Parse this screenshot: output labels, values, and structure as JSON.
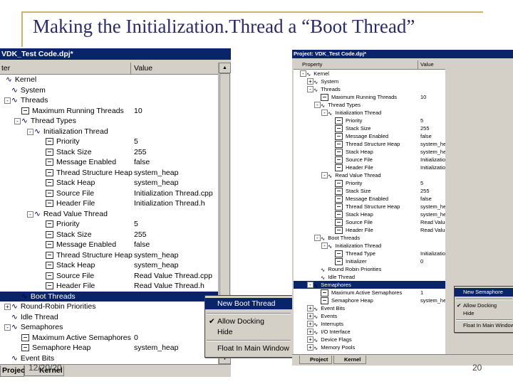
{
  "slide": {
    "title": "Making the Initialization.Thread  a “Boot Thread”",
    "date": "12/20/20",
    "page": "20"
  },
  "colors": {
    "accent_line": "#c9b66a",
    "title_bar": "#0a246a",
    "selection": "#0a246a",
    "panel": "#d4d0c8"
  },
  "left_window": {
    "title": "VDK_Test Code.dpj*",
    "columns": [
      "ter",
      "Value"
    ],
    "rows": [
      {
        "name": "Kernel",
        "value": "",
        "icon": "kernel-icon"
      },
      {
        "name": "System",
        "value": "",
        "icon": "system-icon"
      },
      {
        "name": "Threads",
        "value": "",
        "icon": "threads-icon"
      },
      {
        "name": "Maximum Running Threads",
        "value": "10",
        "icon": "property-icon"
      },
      {
        "name": "Thread Types",
        "value": "",
        "icon": "thread-types-icon"
      },
      {
        "name": "Initialization Thread",
        "value": "",
        "icon": "thread-icon"
      },
      {
        "name": "Priority",
        "value": "5",
        "icon": "property-icon"
      },
      {
        "name": "Stack Size",
        "value": "255",
        "icon": "property-icon"
      },
      {
        "name": "Message Enabled",
        "value": "false",
        "icon": "property-icon"
      },
      {
        "name": "Thread Structure Heap",
        "value": "system_heap",
        "icon": "property-icon"
      },
      {
        "name": "Stack Heap",
        "value": "system_heap",
        "icon": "property-icon"
      },
      {
        "name": "Source File",
        "value": "Initialization Thread.cpp",
        "icon": "property-icon"
      },
      {
        "name": "Header File",
        "value": "Initialization Thread.h",
        "icon": "property-icon"
      },
      {
        "name": "Read Value Thread",
        "value": "",
        "icon": "thread-icon"
      },
      {
        "name": "Priority",
        "value": "5",
        "icon": "property-icon"
      },
      {
        "name": "Stack Size",
        "value": "255",
        "icon": "property-icon"
      },
      {
        "name": "Message Enabled",
        "value": "false",
        "icon": "property-icon"
      },
      {
        "name": "Thread Structure Heap",
        "value": "system_heap",
        "icon": "property-icon"
      },
      {
        "name": "Stack Heap",
        "value": "system_heap",
        "icon": "property-icon"
      },
      {
        "name": "Source File",
        "value": "Read Value Thread.cpp",
        "icon": "property-icon"
      },
      {
        "name": "Header File",
        "value": "Read Value Thread.h",
        "icon": "property-icon"
      },
      {
        "name": "Boot Threads",
        "value": "",
        "icon": "boot-threads-icon"
      },
      {
        "name": "Round-Robin Priorities",
        "value": "",
        "icon": "round-robin-icon"
      },
      {
        "name": "Idle Thread",
        "value": "",
        "icon": "idle-thread-icon"
      },
      {
        "name": "Semaphores",
        "value": "",
        "icon": "semaphores-icon"
      },
      {
        "name": "Maximum Active Semaphores",
        "value": "0",
        "icon": "property-icon"
      },
      {
        "name": "Semaphore Heap",
        "value": "system_heap",
        "icon": "property-icon"
      },
      {
        "name": "Event Bits",
        "value": "",
        "icon": "event-bits-icon"
      }
    ],
    "tabs": [
      "Project",
      "Kernel"
    ],
    "context_menu": {
      "items": [
        "New Boot Thread",
        "Allow Docking",
        "Hide",
        "Float In Main Window"
      ],
      "checked": "Allow Docking",
      "highlighted": "New Boot Thread"
    }
  },
  "right_window": {
    "title": "Project: VDK_Test Code.dpj*",
    "columns": [
      "Property",
      "Value"
    ],
    "rows": [
      {
        "name": "Kernel",
        "value": "",
        "icon": "kernel-icon"
      },
      {
        "name": "System",
        "value": "",
        "icon": "system-icon"
      },
      {
        "name": "Threads",
        "value": "",
        "icon": "threads-icon"
      },
      {
        "name": "Maximum Running Threads",
        "value": "10",
        "icon": "property-icon"
      },
      {
        "name": "Thread Types",
        "value": "",
        "icon": "thread-types-icon"
      },
      {
        "name": "Initialization Thread",
        "value": "",
        "icon": "thread-icon"
      },
      {
        "name": "Priority",
        "value": "5",
        "icon": "property-icon"
      },
      {
        "name": "Stack Size",
        "value": "255",
        "icon": "property-icon"
      },
      {
        "name": "Message Enabled",
        "value": "false",
        "icon": "property-icon"
      },
      {
        "name": "Thread Structure Heap",
        "value": "system_heap",
        "icon": "property-icon"
      },
      {
        "name": "Stack Heap",
        "value": "system_heap",
        "icon": "property-icon"
      },
      {
        "name": "Source File",
        "value": "Initialization Thread.cpp",
        "icon": "property-icon"
      },
      {
        "name": "Header File",
        "value": "Initialization Thread.h",
        "icon": "property-icon"
      },
      {
        "name": "Read Value Thread",
        "value": "",
        "icon": "thread-icon"
      },
      {
        "name": "Priority",
        "value": "5",
        "icon": "property-icon"
      },
      {
        "name": "Stack Size",
        "value": "255",
        "icon": "property-icon"
      },
      {
        "name": "Message Enabled",
        "value": "false",
        "icon": "property-icon"
      },
      {
        "name": "Thread Structure Heap",
        "value": "system_heap",
        "icon": "property-icon"
      },
      {
        "name": "Stack Heap",
        "value": "system_heap",
        "icon": "property-icon"
      },
      {
        "name": "Source File",
        "value": "Read Value Thread.cpp",
        "icon": "property-icon"
      },
      {
        "name": "Header File",
        "value": "Read Value Thread.h",
        "icon": "property-icon"
      },
      {
        "name": "Boot Threads",
        "value": "",
        "icon": "boot-threads-icon"
      },
      {
        "name": "Initialization Thread",
        "value": "",
        "icon": "thread-icon"
      },
      {
        "name": "Thread Type",
        "value": "Initialization Thread",
        "icon": "property-icon"
      },
      {
        "name": "Initializer",
        "value": "0",
        "icon": "property-icon"
      },
      {
        "name": "Round Robin Priorities",
        "value": "",
        "icon": "round-robin-icon"
      },
      {
        "name": "Idle Thread",
        "value": "",
        "icon": "idle-thread-icon"
      },
      {
        "name": "Semaphores",
        "value": "",
        "icon": "semaphores-icon"
      },
      {
        "name": "Maximum Active Semaphores",
        "value": "1",
        "icon": "property-icon"
      },
      {
        "name": "Semaphore Heap",
        "value": "system_heap",
        "icon": "property-icon"
      },
      {
        "name": "Event Bits",
        "value": "",
        "icon": "event-bits-icon"
      },
      {
        "name": "Events",
        "value": "",
        "icon": "events-icon"
      },
      {
        "name": "Interrupts",
        "value": "",
        "icon": "interrupts-icon"
      },
      {
        "name": "I/O Interface",
        "value": "",
        "icon": "io-interface-icon"
      },
      {
        "name": "Device Flags",
        "value": "",
        "icon": "device-flags-icon"
      },
      {
        "name": "Memory Pools",
        "value": "",
        "icon": "memory-pools-icon"
      }
    ],
    "tabs": [
      "Project",
      "Kernel"
    ],
    "context_menu": {
      "items": [
        "New Semaphore",
        "Allow Docking",
        "Hide",
        "Float In Main Window"
      ],
      "checked": "Allow Docking",
      "highlighted": "New Semaphore"
    }
  }
}
